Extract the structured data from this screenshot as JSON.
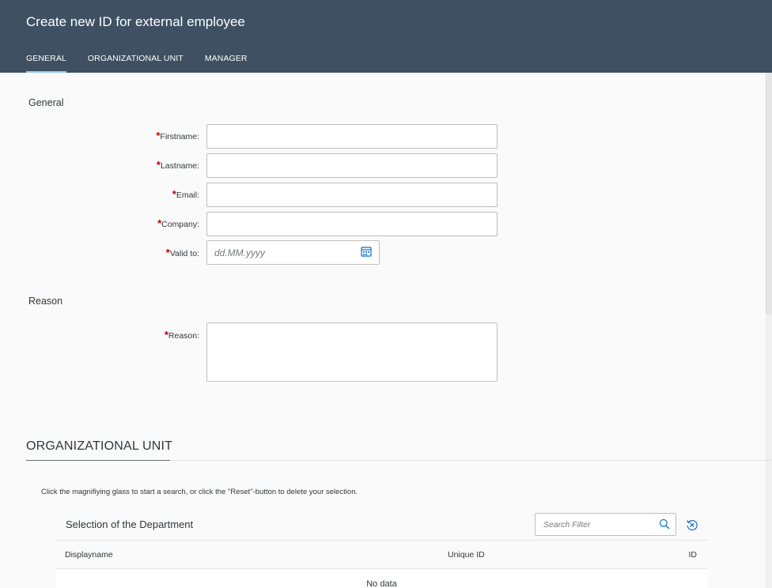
{
  "header": {
    "title": "Create new ID for external employee",
    "tabs": [
      {
        "label": "GENERAL",
        "active": true
      },
      {
        "label": "ORGANIZATIONAL UNIT",
        "active": false
      },
      {
        "label": "MANAGER",
        "active": false
      }
    ]
  },
  "general": {
    "section_title": "General",
    "required_marker": "*",
    "fields": {
      "firstname": {
        "label": "Firstname:",
        "value": ""
      },
      "lastname": {
        "label": "Lastname:",
        "value": ""
      },
      "email": {
        "label": "Email:",
        "value": ""
      },
      "company": {
        "label": "Company:",
        "value": ""
      },
      "valid_to": {
        "label": "Valid to:",
        "value": "",
        "placeholder": "dd.MM.yyyy"
      }
    }
  },
  "reason": {
    "section_title": "Reason",
    "field": {
      "label": "Reason:",
      "value": ""
    }
  },
  "org_unit": {
    "title": "ORGANIZATIONAL UNIT",
    "hint": "Click the magnifiying glass to start a search, or click the \"Reset\"-button to delete your selection.",
    "table": {
      "title": "Selection of the Department",
      "search_placeholder": "Search Filter",
      "columns": [
        "Displayname",
        "Unique ID",
        "ID"
      ],
      "empty_text": "No data"
    }
  },
  "colors": {
    "header_bg": "#3e5062",
    "active_tab_indicator": "#91c8f6",
    "required": "#bb0000",
    "page_bg": "#fafafa"
  },
  "icons": {
    "calendar": "calendar-icon",
    "search": "search-icon",
    "reset": "reset-icon"
  }
}
